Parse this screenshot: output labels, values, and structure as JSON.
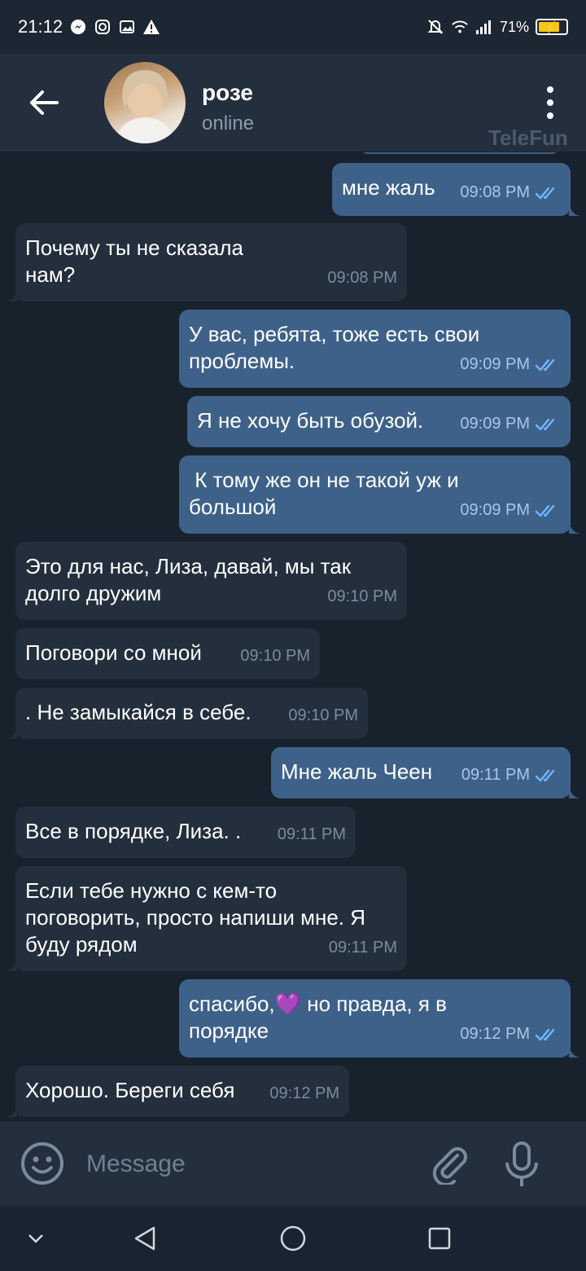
{
  "status_bar": {
    "time": "21:12",
    "battery": "71%"
  },
  "header": {
    "contact_name": "розе",
    "contact_status": "online",
    "watermark": "TeleFun"
  },
  "composer": {
    "placeholder": "Message"
  },
  "messages": [
    {
      "dir": "out",
      "text": "мне жаль",
      "time": "09:08 PM",
      "read": true
    },
    {
      "dir": "in",
      "text": "Почему ты не сказала\nнам?",
      "time": "09:08 PM"
    },
    {
      "dir": "out",
      "text": "У вас, ребята, тоже есть свои\nпроблемы.",
      "time": "09:09 PM",
      "read": true
    },
    {
      "dir": "out",
      "text": "Я не хочу быть обузой.",
      "time": "09:09 PM",
      "read": true
    },
    {
      "dir": "out",
      "text": " К тому же он не такой уж и\nбольшой",
      "time": "09:09 PM",
      "read": true
    },
    {
      "dir": "in",
      "text": "Это для нас, Лиза, давай, мы так\nдолго дружим",
      "time": "09:10 PM"
    },
    {
      "dir": "in",
      "text": "Поговори со мной",
      "time": "09:10 PM"
    },
    {
      "dir": "in",
      "text": ". Не замыкайся в себе.",
      "time": "09:10 PM"
    },
    {
      "dir": "out",
      "text": "Мне жаль Чеен",
      "time": "09:11 PM",
      "read": true
    },
    {
      "dir": "in",
      "text": "Все в порядке, Лиза. .",
      "time": "09:11 PM"
    },
    {
      "dir": "in",
      "text": "Если тебе нужно с кем-то\nпоговорить, просто напиши мне. Я\nбуду рядом",
      "time": "09:11 PM"
    },
    {
      "dir": "out",
      "text": "спасибо,💜 но правда, я в\nпорядке",
      "time": "09:12 PM",
      "read": true
    },
    {
      "dir": "in",
      "text": "Хорошо. Береги себя",
      "time": "09:12 PM"
    }
  ]
}
